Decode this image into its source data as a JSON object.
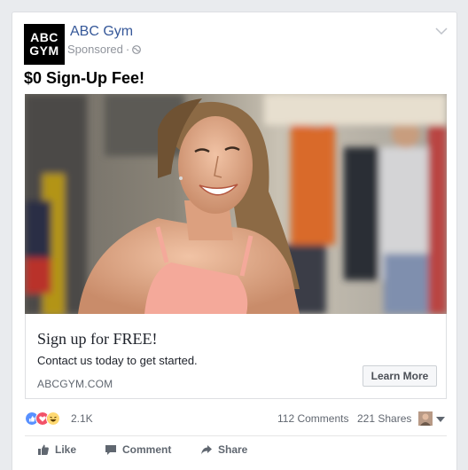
{
  "post": {
    "logo_line1": "ABC",
    "logo_line2": "GYM",
    "page_name": "ABC Gym",
    "sponsored": "Sponsored",
    "headline": "$0 Sign-Up Fee!"
  },
  "link": {
    "title": "Sign up for FREE!",
    "description": "Contact us today to get started.",
    "domain": "ABCGYM.COM",
    "cta": "Learn More"
  },
  "stats": {
    "reactions": "2.1K",
    "comments": "112 Comments",
    "shares": "221 Shares"
  },
  "actions": {
    "like": "Like",
    "comment": "Comment",
    "share": "Share"
  },
  "colors": {
    "link_blue": "#365899",
    "muted": "#90949c",
    "like_blue": "#5890ff",
    "love_red": "#f25268",
    "haha_yellow": "#ffd972"
  }
}
